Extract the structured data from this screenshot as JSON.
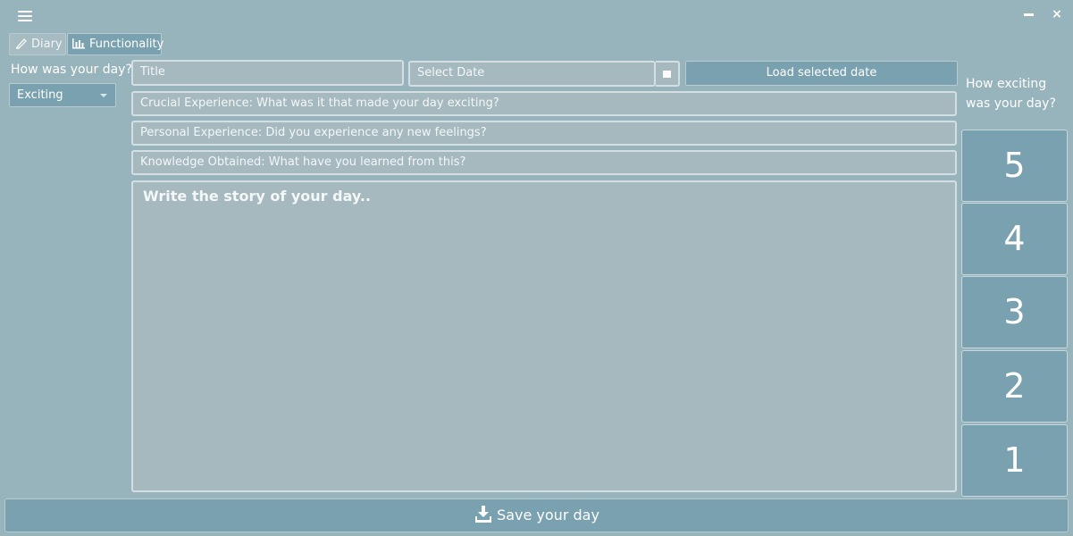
{
  "window": {
    "menu_icon": "hamburger-icon",
    "minimize_icon": "minimize-icon",
    "close_glyph": "×"
  },
  "tabs": [
    {
      "label": "Diary",
      "icon": "pen-icon",
      "active": false
    },
    {
      "label": "Functionality",
      "icon": "bar-chart-icon",
      "active": true
    }
  ],
  "mood": {
    "question": "How was your day?",
    "selected": "Exciting"
  },
  "entry": {
    "title_placeholder": "Title",
    "date_placeholder": "Select Date",
    "load_button": "Load selected date",
    "crucial_placeholder": "Crucial Experience: What was it that made your day exciting?",
    "personal_placeholder": "Personal Experience: Did you experience any new feelings?",
    "knowledge_placeholder": "Knowledge Obtained: What have you learned from this?",
    "story_placeholder": "Write the story of your day.."
  },
  "rating": {
    "question": "How exciting was your day?",
    "options": [
      "5",
      "4",
      "3",
      "2",
      "1"
    ]
  },
  "save_button": {
    "label": "Save your day",
    "icon": "download-icon"
  },
  "colors": {
    "background": "#97b3bc",
    "accent": "#7aa1af",
    "field": "#a5b9bf"
  }
}
